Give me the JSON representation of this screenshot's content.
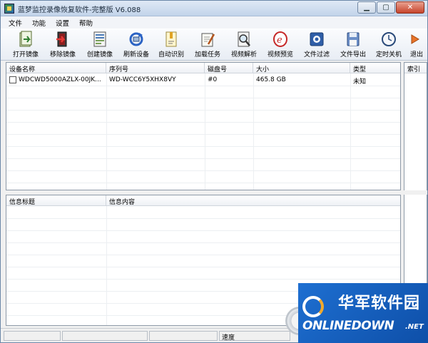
{
  "window": {
    "title": "蓝梦监控录像恢复软件-完整版 V6.088"
  },
  "menu": [
    "文件",
    "功能",
    "设置",
    "帮助"
  ],
  "toolbar": [
    {
      "label": "打开镜像",
      "icon": "open-image-icon"
    },
    {
      "label": "移除镜像",
      "icon": "remove-image-icon"
    },
    {
      "label": "创建镜像",
      "icon": "create-image-icon"
    },
    {
      "label": "刷新设备",
      "icon": "refresh-device-icon"
    },
    {
      "label": "自动识别",
      "icon": "auto-detect-icon"
    },
    {
      "label": "加载任务",
      "icon": "load-task-icon"
    },
    {
      "label": "视频解析",
      "icon": "video-parse-icon"
    },
    {
      "label": "视频预览",
      "icon": "video-preview-icon"
    },
    {
      "label": "文件过滤",
      "icon": "file-filter-icon"
    },
    {
      "label": "文件导出",
      "icon": "file-export-icon"
    },
    {
      "label": "定时关机",
      "icon": "timer-shutdown-icon"
    },
    {
      "label": "退出",
      "icon": "exit-icon"
    }
  ],
  "device_table": {
    "columns": [
      "设备名称",
      "序列号",
      "磁盘号",
      "大小",
      "类型"
    ],
    "rows": [
      {
        "name": "WDCWD5000AZLX-00JK...",
        "serial": "WD-WCC6Y5XHX8VY",
        "disk": "#0",
        "size": "465.8 GB",
        "type": "未知"
      }
    ]
  },
  "index_panel": {
    "header": "索引"
  },
  "info_table": {
    "columns": [
      "信息标题",
      "信息内容"
    ]
  },
  "status": {
    "speed_label": "速度"
  },
  "watermark": {
    "cn": "华军软件园",
    "en": "ONLINEDOWN",
    "net": ".NET"
  },
  "colors": {
    "accent": "#1e6fd1",
    "close": "#c7452c"
  }
}
